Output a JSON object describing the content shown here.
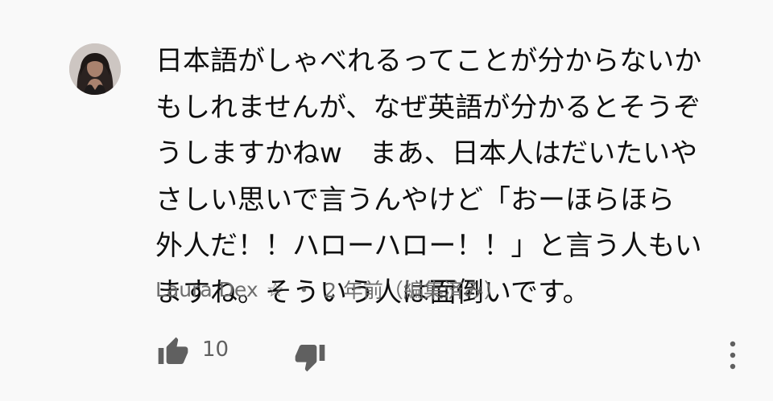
{
  "comment": {
    "author": {
      "name": "Laura Dex",
      "badge": "☆",
      "avatar_icon": "user-avatar"
    },
    "text": "日本語がしゃべれるってことが分からないかもしれませんが、なぜ英語が分かるとそうぞうしますかねw　まあ、日本人はだいたいやさしい思いで言うんやけど「おーほらほら\n外人だ！！ハローハロー！！」と言う人もいますね。そういう人は面倒いです。",
    "separator": "・",
    "timestamp": "2 年前（編集済み）",
    "likes": "10",
    "icons": {
      "like": "thumbs-up-icon",
      "dislike": "thumbs-down-icon",
      "menu": "more-vertical-icon"
    }
  },
  "colors": {
    "background": "#f9f9f9",
    "text": "#0f0f0f",
    "meta": "#6e6e6e",
    "icon": "#606060"
  }
}
